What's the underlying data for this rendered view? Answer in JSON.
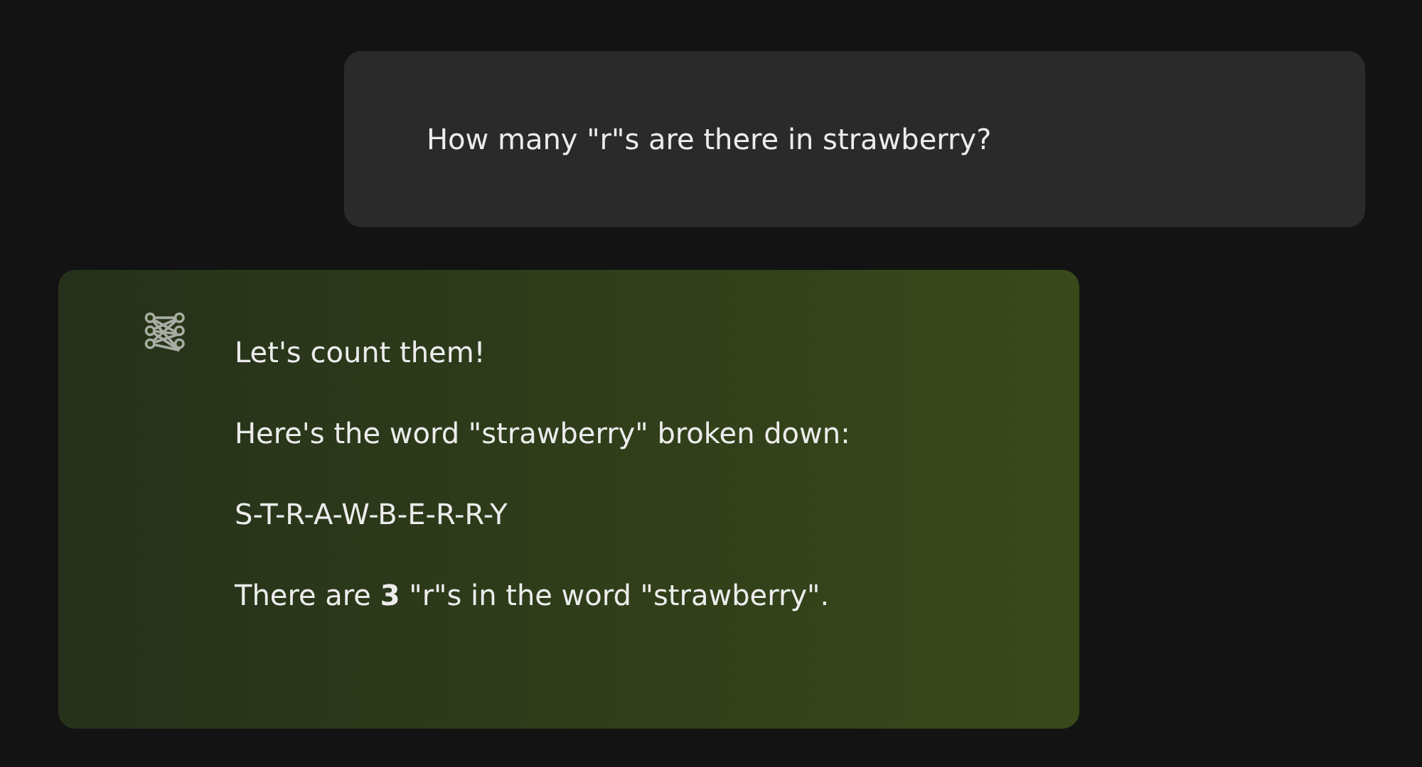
{
  "messages": [
    {
      "kind": "user",
      "paragraphs": [
        "How many \"r\"s are there in strawberry?"
      ]
    },
    {
      "kind": "assistant",
      "paragraphs": [
        "Let's count them!",
        "Here's the word \"strawberry\" broken down:",
        "S-T-R-A-W-B-E-R-R-Y",
        "There are **3** \"r\"s in the word \"strawberry\"."
      ]
    }
  ]
}
